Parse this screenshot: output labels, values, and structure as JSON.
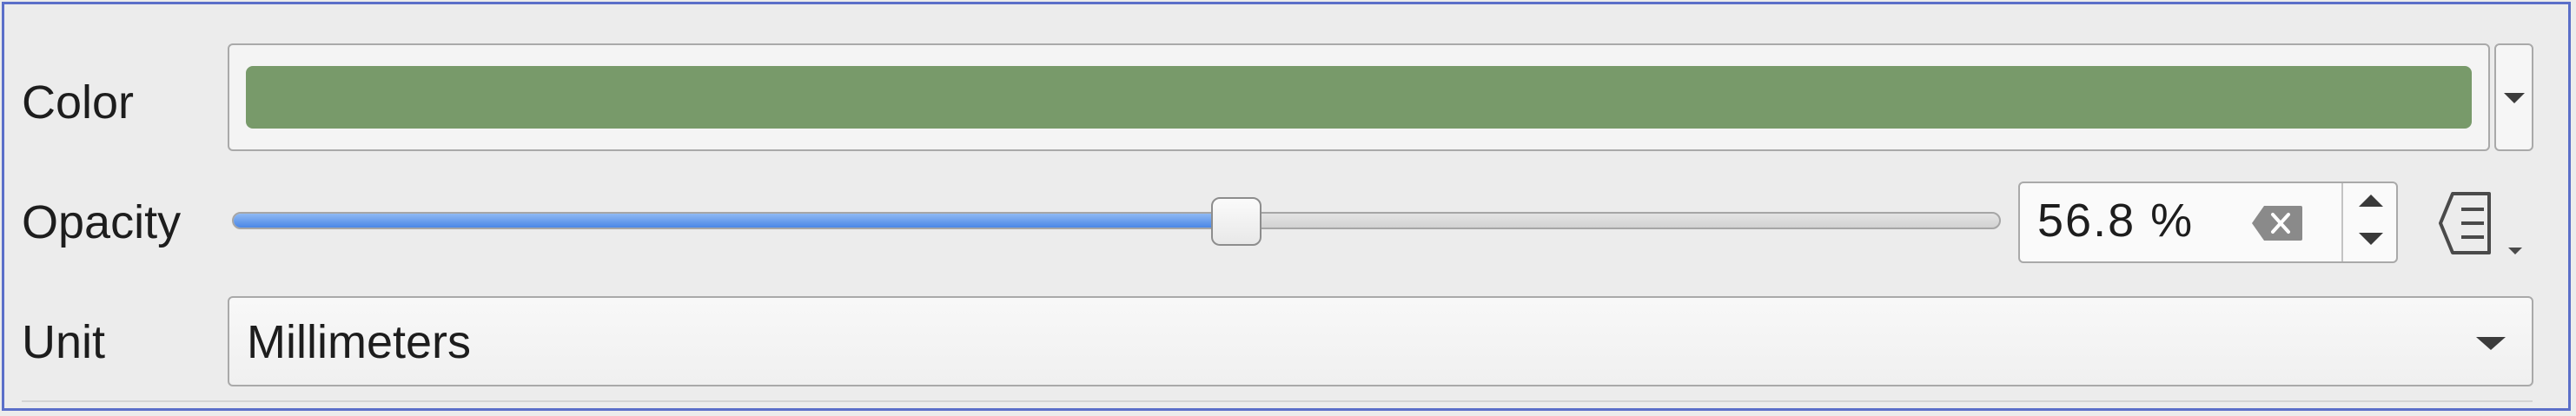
{
  "labels": {
    "color": "Color",
    "opacity": "Opacity",
    "unit": "Unit"
  },
  "color": {
    "swatch_hex": "#789a6a"
  },
  "opacity": {
    "percent": 56.8,
    "display": "56.8 %"
  },
  "unit": {
    "selected": "Millimeters"
  },
  "icons": {
    "color_dropdown": "chevron-down-icon",
    "clear": "clear-icon",
    "spin_up": "spin-up-icon",
    "spin_down": "spin-down-icon",
    "data_defined": "data-defined-override-icon",
    "unit_dropdown": "chevron-down-icon"
  },
  "colors": {
    "accent": "#4b87e6",
    "panel_border": "#5b6fc9"
  }
}
